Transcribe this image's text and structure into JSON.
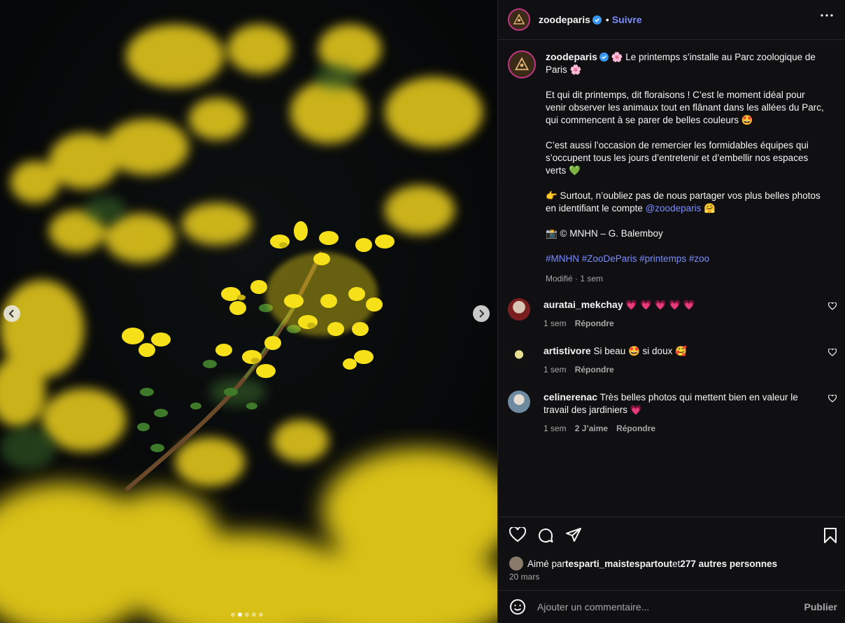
{
  "post": {
    "username": "zoodeparis",
    "follow_label": "Suivre",
    "separator": "•",
    "caption": {
      "line1": " 🌸 Le printemps s’installe au Parc zoologique de Paris 🌸",
      "para2": "Et qui dit printemps, dit floraisons ! C’est le moment idéal pour venir observer les animaux tout en flânant dans les allées du Parc, qui commencent à se parer de belles couleurs 🤩",
      "para3": "C’est aussi l’occasion de remercier les formidables équipes qui s’occupent tous les jours d’entretenir et d’embellir nos espaces verts 💚",
      "para4_pre": "👉 Surtout, n’oubliez pas de nous partager vos plus belles photos en identifiant le compte ",
      "para4_mention": "@zoodeparis",
      "para4_post": " 🤗",
      "credit": "📸 © MNHN – G. Balemboy",
      "hashtags": "#MNHN #ZooDeParis #printemps #zoo",
      "meta": "Modifié · 1 sem"
    },
    "comments": [
      {
        "user": "auratai_mekchay",
        "text": " 💗 💗 💗 💗 💗",
        "time": "1 sem",
        "likes": "",
        "reply": "Répondre"
      },
      {
        "user": "artistivore",
        "text": " Si beau 🤩 si doux 🥰",
        "time": "1 sem",
        "likes": "",
        "reply": "Répondre"
      },
      {
        "user": "celinerenac",
        "text": " Très belles photos qui mettent bien en valeur le travail des jardiniers 💗",
        "time": "1 sem",
        "likes": "2 J’aime",
        "reply": "Répondre"
      }
    ],
    "likes": {
      "prefix": "Aimé par ",
      "user": "tesparti_maistespartout",
      "mid": " et ",
      "others": "277 autres personnes"
    },
    "date": "20 mars",
    "comment_placeholder": "Ajouter un commentaire...",
    "publish_label": "Publier"
  },
  "carousel": {
    "total": 5,
    "active_index": 1
  },
  "colors": {
    "accent": "#7b8cff",
    "panel_bg": "#101012",
    "text": "#f5f5f5",
    "muted": "#a8a8a8"
  }
}
